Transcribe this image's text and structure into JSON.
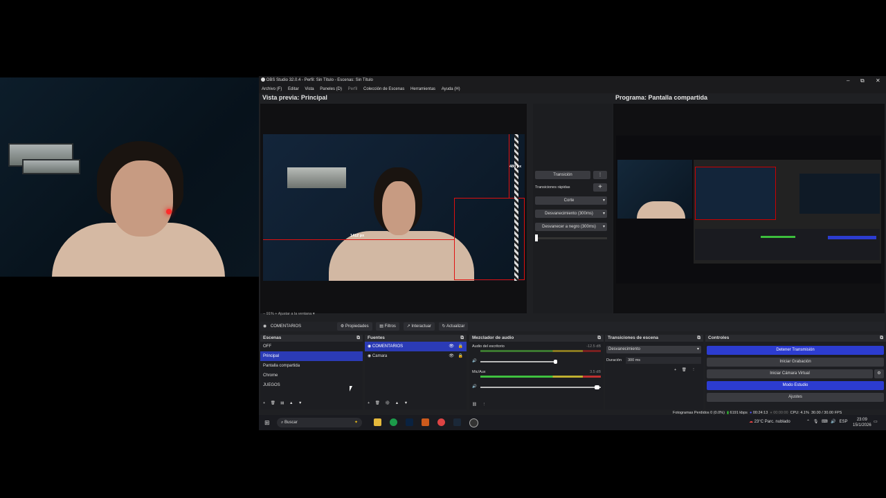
{
  "window": {
    "title": "OBS Studio 32.0.4 - Perfil: Sin Título - Escenas: Sin Título",
    "controls": [
      "–",
      "⧉",
      "✕"
    ]
  },
  "menu": [
    "Archivo (F)",
    "Editar",
    "Vista",
    "Paneles (D)",
    "Perfil",
    "Colección de Escenas",
    "Herramientas",
    "Ayuda (H)"
  ],
  "preview": {
    "title": "Vista previa: Principal",
    "dim_w": "1412 px",
    "dim_h": "480 px",
    "zoom": "91%",
    "fit_label": "Ajustar a la ventana"
  },
  "program": {
    "title": "Programa: Pantalla compartida"
  },
  "transitions_panel": {
    "transition_btn": "Transición",
    "quick_label": "Transiciones rápidas",
    "items": [
      "Corte",
      "Desvanecimiento (300ms)",
      "Desvanecer a negro (300ms)"
    ]
  },
  "source_toolbar": {
    "source_name": "COMENTARIOS",
    "buttons": [
      "Propiedades",
      "Filtros",
      "Interactuar",
      "Actualizar"
    ]
  },
  "scenes": {
    "title": "Escenas",
    "items": [
      "OFF",
      "Principal",
      "Pantalla compartida",
      "Chrome",
      "JUEGOS"
    ],
    "selected": 1
  },
  "sources": {
    "title": "Fuentes",
    "items": [
      "COMENTARIOS",
      "Camara"
    ],
    "selected": 0
  },
  "mixer": {
    "title": "Mezclador de audio",
    "channels": [
      {
        "name": "Audio del escritorio",
        "db": "-12.5 dB",
        "level": 0.82
      },
      {
        "name": "Mic/Aux",
        "db": "3.5 dB",
        "level": 0.72
      }
    ],
    "scale": [
      "-60",
      "-55",
      "-50",
      "-45",
      "-40",
      "-35",
      "-30",
      "-25",
      "-20",
      "-15",
      "-10",
      "-5",
      "0"
    ]
  },
  "scene_transitions": {
    "title": "Transiciones de escena",
    "type": "Desvanecimiento",
    "duration_label": "Duración",
    "duration_value": "300 ms"
  },
  "controls": {
    "title": "Controles",
    "buttons": [
      "Detener Transmisión",
      "Iniciar Grabación",
      "Iniciar Cámara Virtual",
      "Modo Estudio",
      "Ajustes"
    ]
  },
  "status": {
    "dropped": "Fotogramas Perdidos 0 (0.0%)",
    "bitrate": "6191 kbps",
    "live_time": "00:24:13",
    "rec_time": "00:00:00",
    "cpu": "CPU: 4.1%",
    "fps": "30.00 / 30.00 FPS"
  },
  "taskbar": {
    "search": "Buscar",
    "weather": "23°C  Parc. nublado",
    "lang": "ESP",
    "time": "23:09",
    "date": "15/1/2026"
  },
  "colors": {
    "accent": "#2c3cd0",
    "guide": "#e01010"
  }
}
